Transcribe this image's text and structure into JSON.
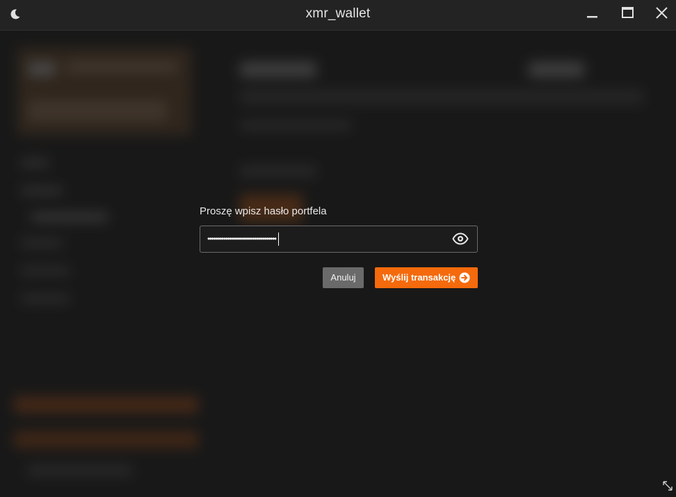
{
  "window": {
    "title": "xmr_wallet",
    "theme_icon": "moon-icon",
    "controls": [
      "minimize-icon",
      "maximize-icon",
      "close-icon"
    ]
  },
  "dialog": {
    "prompt": "Proszę wpisz hasło portfela",
    "password_masked": "••••••••••••••••••••••••••••••••••",
    "show_password_icon": "eye-icon",
    "cancel_label": "Anuluj",
    "send_label": "Wyślij transakcję",
    "send_icon": "arrow-right-circle-icon"
  },
  "colors": {
    "accent": "#f46a0c",
    "cancel_button": "#6a6a6a",
    "background": "#1d1d1d"
  },
  "resize_icon": "resize-diagonal-icon"
}
